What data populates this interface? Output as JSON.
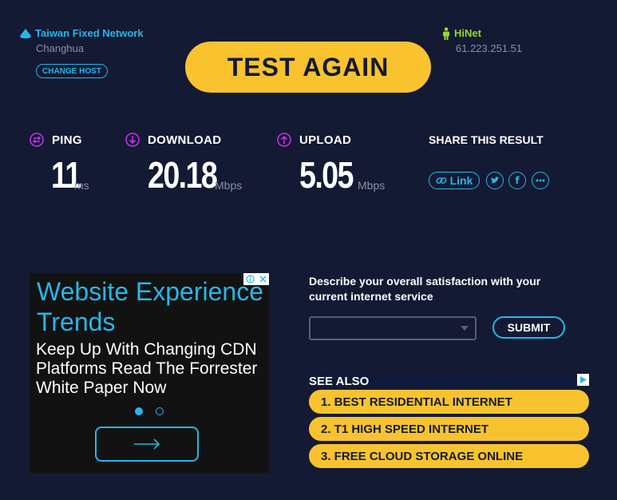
{
  "host": {
    "provider": "Taiwan Fixed Network",
    "city": "Changhua",
    "change_label": "CHANGE HOST"
  },
  "isp": {
    "name": "HiNet",
    "ip": "61.223.251.51"
  },
  "test_again_label": "TEST AGAIN",
  "metrics": {
    "ping": {
      "label": "PING",
      "value": "11",
      "unit": "ms"
    },
    "download": {
      "label": "DOWNLOAD",
      "value": "20.18",
      "unit": "Mbps"
    },
    "upload": {
      "label": "UPLOAD",
      "value": "5.05",
      "unit": "Mbps"
    }
  },
  "share": {
    "title": "SHARE THIS RESULT",
    "link_label": "Link"
  },
  "ad": {
    "headline": "Website Experience Trends",
    "body": "Keep Up With Changing CDN Platforms Read The Forrester White Paper Now"
  },
  "survey": {
    "question": "Describe your overall satisfaction with your current internet service",
    "select_value": "",
    "submit_label": "SUBMIT"
  },
  "see_also": {
    "title": "SEE ALSO",
    "items": [
      "1.  BEST RESIDENTIAL INTERNET",
      "2.  T1 HIGH SPEED INTERNET",
      "3.  FREE CLOUD STORAGE ONLINE"
    ]
  },
  "colors": {
    "background": "#141a33",
    "accent_blue": "#27b6e8",
    "accent_yellow": "#f8c32f",
    "accent_green": "#92d82a",
    "metric_icon": "#c032e6"
  }
}
